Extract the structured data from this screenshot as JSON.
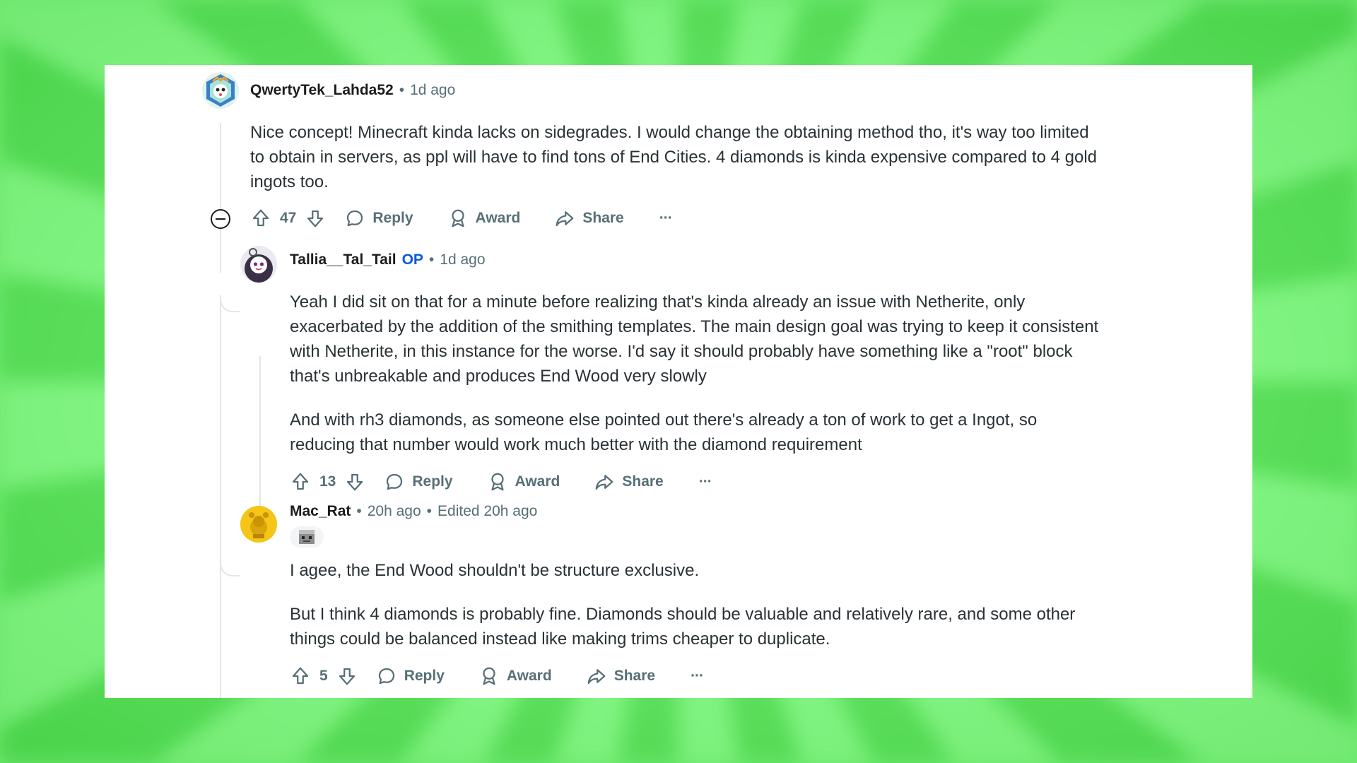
{
  "colors": {
    "background_green": "#6ee86e",
    "card": "#ffffff",
    "username": "#1c1c1c",
    "meta": "#576f76",
    "op_badge": "#0a5cd6",
    "body_text": "#2a3236"
  },
  "comments": [
    {
      "username": "QwertyTek_Lahda52",
      "sep": "•",
      "time": "1d ago",
      "paragraphs": [
        "Nice concept! Minecraft kinda lacks on sidegrades. I would change the obtaining method tho, it's way too limited to obtain in servers, as ppl will have to find tons of End Cities. 4 diamonds is kinda expensive compared to 4 gold ingots too."
      ],
      "votes": "47",
      "reply_label": "Reply",
      "award_label": "Award",
      "share_label": "Share",
      "more_label": "···"
    },
    {
      "username": "Tallia__Tal_Tail",
      "op_label": "OP",
      "sep": "•",
      "time": "1d ago",
      "paragraphs": [
        "Yeah I did sit on that for a minute before realizing that's kinda already an issue with Netherite, only exacerbated by the addition of the smithing templates. The main design goal was trying to keep it consistent with Netherite, in this instance for the worse. I'd say it should probably have something like a \"root\" block that's unbreakable and produces End Wood very slowly",
        "And with rh3 diamonds, as someone else pointed out there's already a ton of work to get a Ingot, so reducing that number would work much better with the diamond requirement"
      ],
      "votes": "13",
      "reply_label": "Reply",
      "award_label": "Award",
      "share_label": "Share",
      "more_label": "···"
    },
    {
      "username": "Mac_Rat",
      "sep": "•",
      "time": "20h ago",
      "sep2": "•",
      "edited": "Edited 20h ago",
      "paragraphs": [
        "I agee, the End Wood shouldn't be structure exclusive.",
        "But I think 4 diamonds is probably fine. Diamonds should be valuable and relatively rare, and some other things could be balanced instead like making trims cheaper to duplicate."
      ],
      "votes": "5",
      "reply_label": "Reply",
      "award_label": "Award",
      "share_label": "Share",
      "more_label": "···"
    }
  ],
  "icons": [
    "upvote-icon",
    "downvote-icon",
    "reply-bubble-icon",
    "award-icon",
    "share-icon",
    "more-options-icon",
    "collapse-icon"
  ]
}
